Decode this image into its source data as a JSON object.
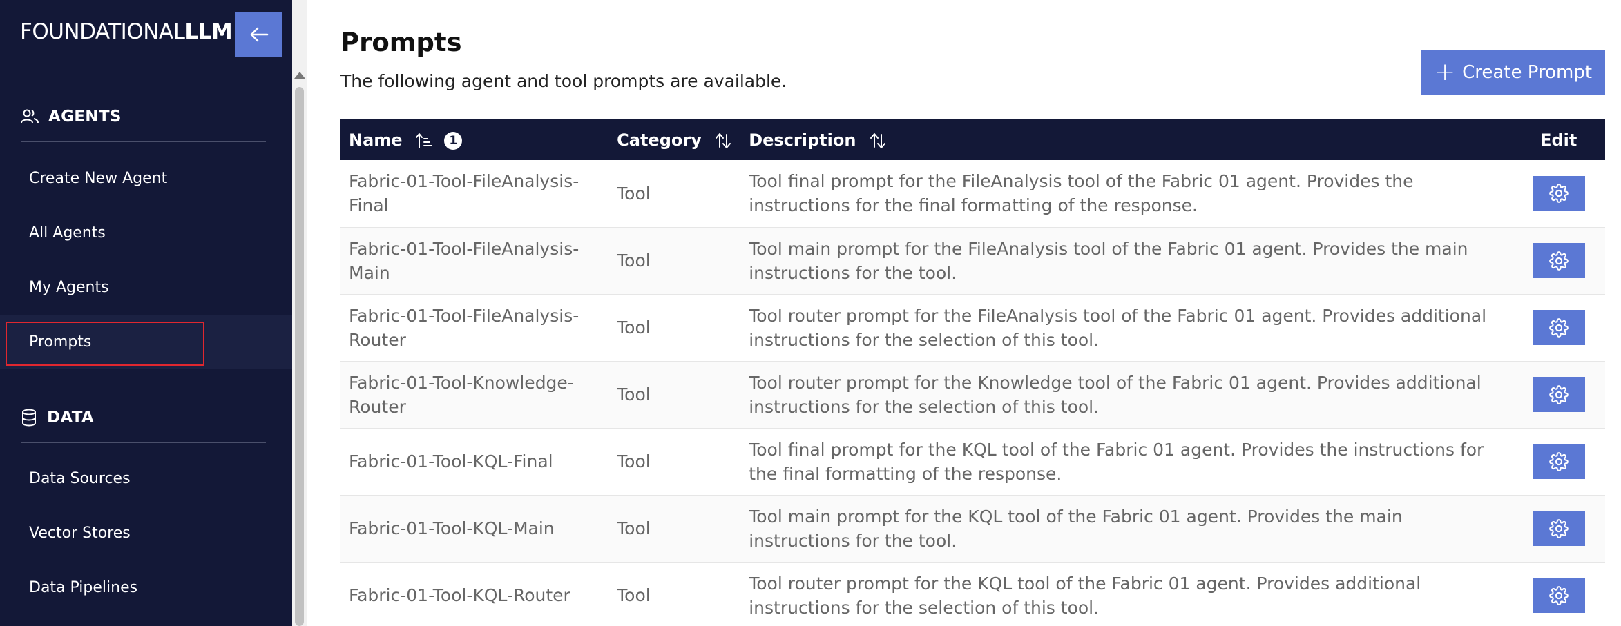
{
  "sidebar": {
    "logo_thin": "FOUNDATIONAL",
    "logo_bold": "LLM",
    "sections": [
      {
        "title": "AGENTS",
        "icon": "users-icon"
      },
      {
        "title": "DATA",
        "icon": "database-icon"
      }
    ],
    "agents_items": [
      "Create New Agent",
      "All Agents",
      "My Agents",
      "Prompts"
    ],
    "data_items": [
      "Data Sources",
      "Vector Stores",
      "Data Pipelines"
    ]
  },
  "main": {
    "title": "Prompts",
    "subtitle": "The following agent and tool prompts are available.",
    "create_button": "Create Prompt",
    "table": {
      "columns": {
        "name": "Name",
        "category": "Category",
        "description": "Description",
        "edit": "Edit"
      },
      "sort_badge": "1",
      "rows": [
        {
          "name": "Fabric-01-Tool-FileAnalysis-Final",
          "category": "Tool",
          "description": "Tool final prompt for the FileAnalysis tool of the Fabric 01 agent. Provides the instructions for the final formatting of the response."
        },
        {
          "name": "Fabric-01-Tool-FileAnalysis-Main",
          "category": "Tool",
          "description": "Tool main prompt for the FileAnalysis tool of the Fabric 01 agent. Provides the main instructions for the tool."
        },
        {
          "name": "Fabric-01-Tool-FileAnalysis-Router",
          "category": "Tool",
          "description": "Tool router prompt for the FileAnalysis tool of the Fabric 01 agent. Provides additional instructions for the selection of this tool."
        },
        {
          "name": "Fabric-01-Tool-Knowledge-Router",
          "category": "Tool",
          "description": "Tool router prompt for the Knowledge tool of the Fabric 01 agent. Provides additional instructions for the selection of this tool."
        },
        {
          "name": "Fabric-01-Tool-KQL-Final",
          "category": "Tool",
          "description": "Tool final prompt for the KQL tool of the Fabric 01 agent. Provides the instructions for the final formatting of the response."
        },
        {
          "name": "Fabric-01-Tool-KQL-Main",
          "category": "Tool",
          "description": "Tool main prompt for the KQL tool of the Fabric 01 agent. Provides the main instructions for the tool."
        },
        {
          "name": "Fabric-01-Tool-KQL-Router",
          "category": "Tool",
          "description": "Tool router prompt for the KQL tool of the Fabric 01 agent. Provides additional instructions for the selection of this tool."
        }
      ]
    }
  },
  "colors": {
    "sidebar_bg": "#131837",
    "accent": "#5b78d4",
    "highlight_border": "#e0272f"
  }
}
